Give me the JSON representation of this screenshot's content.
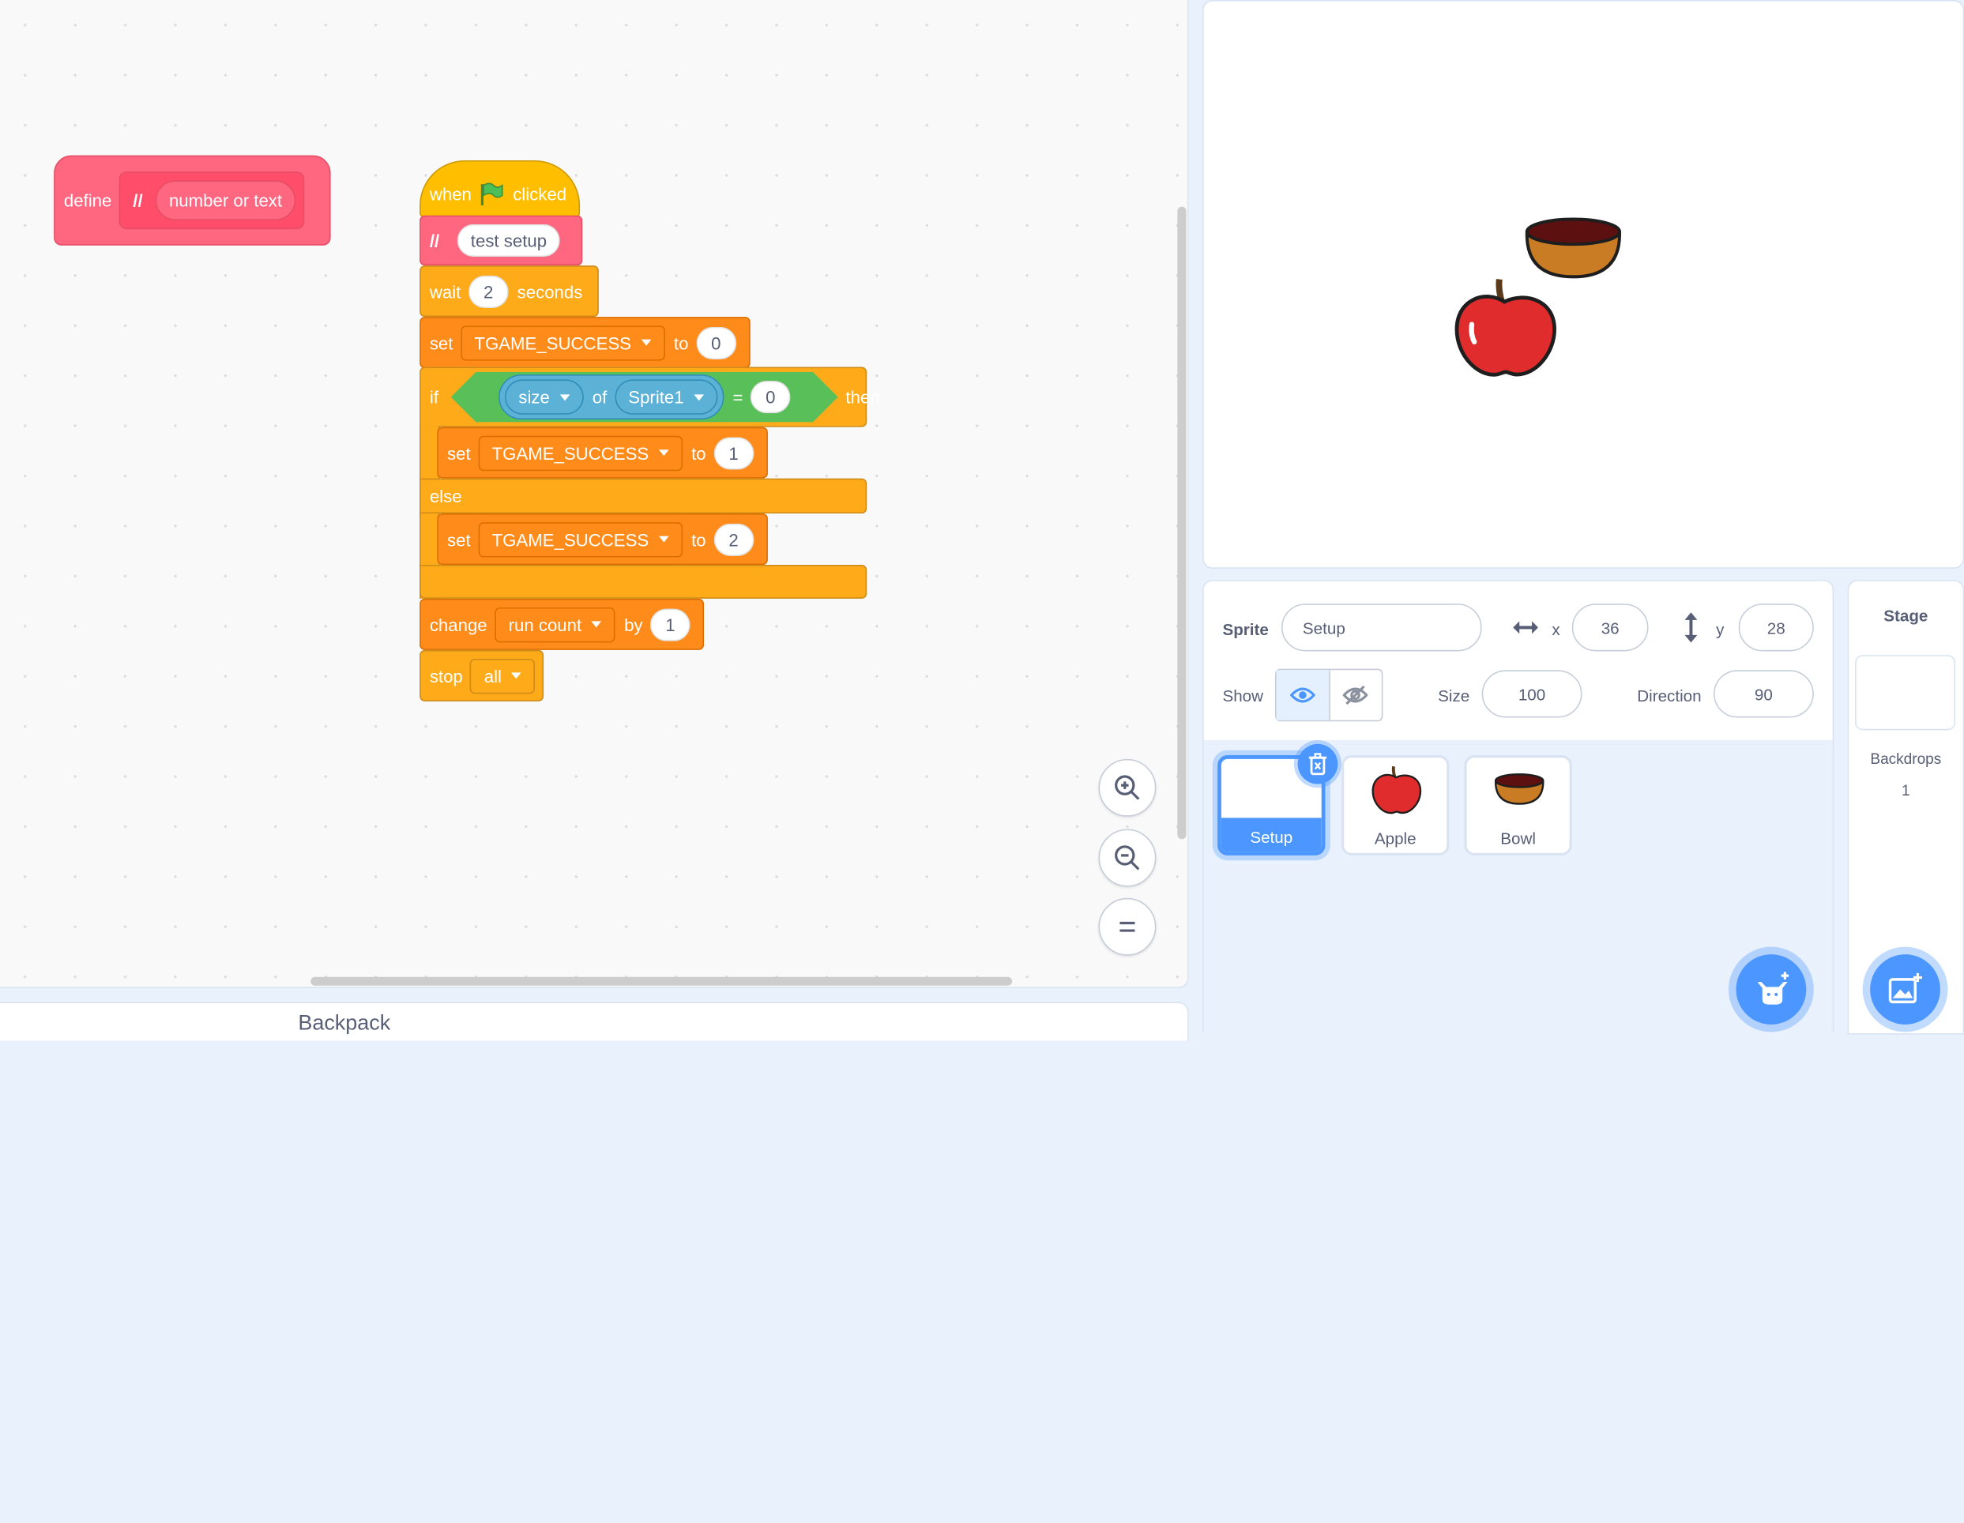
{
  "code": {
    "define_block": {
      "label": "define",
      "slash": "//",
      "param": "number or text"
    },
    "script": {
      "hat": {
        "when": "when",
        "clicked": "clicked"
      },
      "comment": {
        "slash": "//",
        "text": "test setup"
      },
      "wait": {
        "label": "wait",
        "value": "2",
        "unit": "seconds"
      },
      "set1": {
        "label": "set",
        "var": "TGAME_SUCCESS",
        "to": "to",
        "value": "0"
      },
      "if_block": {
        "if": "if",
        "prop": "size",
        "of": "of",
        "target": "Sprite1",
        "eq": "=",
        "value": "0",
        "then": "then",
        "else": "else"
      },
      "set2": {
        "label": "set",
        "var": "TGAME_SUCCESS",
        "to": "to",
        "value": "1"
      },
      "set3": {
        "label": "set",
        "var": "TGAME_SUCCESS",
        "to": "to",
        "value": "2"
      },
      "change": {
        "label": "change",
        "var": "run count",
        "by": "by",
        "value": "1"
      },
      "stop": {
        "label": "stop",
        "option": "all"
      }
    }
  },
  "backpack": {
    "label": "Backpack"
  },
  "sprite_info": {
    "sprite_label": "Sprite",
    "sprite_name": "Setup",
    "x_label": "x",
    "x": "36",
    "y_label": "y",
    "y": "28",
    "show_label": "Show",
    "size_label": "Size",
    "size": "100",
    "direction_label": "Direction",
    "direction": "90"
  },
  "sprites": [
    {
      "name": "Setup",
      "selected": true
    },
    {
      "name": "Apple",
      "selected": false
    },
    {
      "name": "Bowl",
      "selected": false
    }
  ],
  "stage_panel": {
    "title": "Stage",
    "backdrops_label": "Backdrops",
    "backdrops_count": "1"
  },
  "colors": {
    "accent": "#4c97ff",
    "event": "#ffbf00",
    "control": "#ffab19",
    "variables": "#ff8c1a",
    "my_blocks": "#ff6680",
    "operators": "#59c059",
    "sensing": "#5cb1d6"
  }
}
